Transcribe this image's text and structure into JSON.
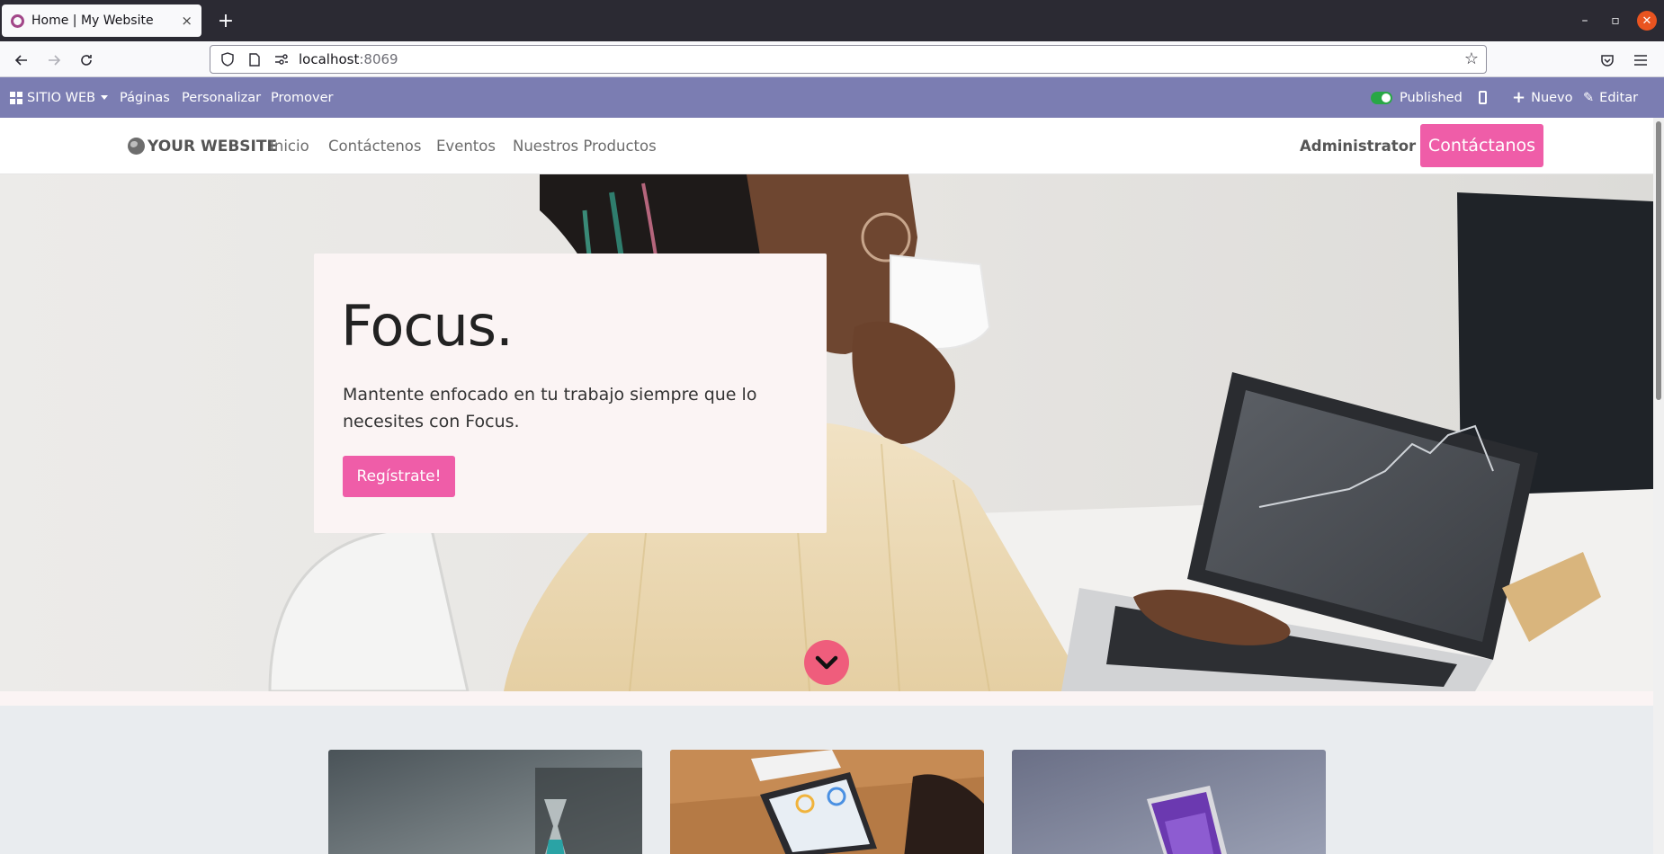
{
  "browser": {
    "tab_title": "Home | My Website",
    "tab_close": "×",
    "new_tab": "+",
    "url_host": "localhost",
    "url_port": ":8069",
    "window_controls": {
      "minimize": "–",
      "restore": "▫",
      "close": "✕"
    }
  },
  "odoo_bar": {
    "apps_label": "SITIO WEB",
    "pages": "Páginas",
    "customize": "Personalizar",
    "promote": "Promover",
    "published": "Published",
    "new": "Nuevo",
    "edit": "Editar",
    "color": "#7b7db2"
  },
  "site_header": {
    "brand": "YOUR WEBSITE",
    "menu": [
      "Inicio",
      "Contáctenos",
      "Eventos",
      "Nuestros Productos"
    ],
    "user": "Administrator",
    "cta": "Contáctanos",
    "accent": "#ef5da8"
  },
  "hero": {
    "title": "Focus.",
    "text": "Mantente enfocado en tu trabajo siempre que lo necesites con Focus.",
    "button": "Regístrate!"
  },
  "icons": [
    "apps-icon",
    "toggle-icon",
    "mobile-icon",
    "plus-icon",
    "pencil-icon",
    "globe-icon",
    "chevron-down-icon",
    "shield-icon",
    "page-icon",
    "permissions-icon",
    "star-icon",
    "pocket-icon",
    "hamburger-icon"
  ]
}
